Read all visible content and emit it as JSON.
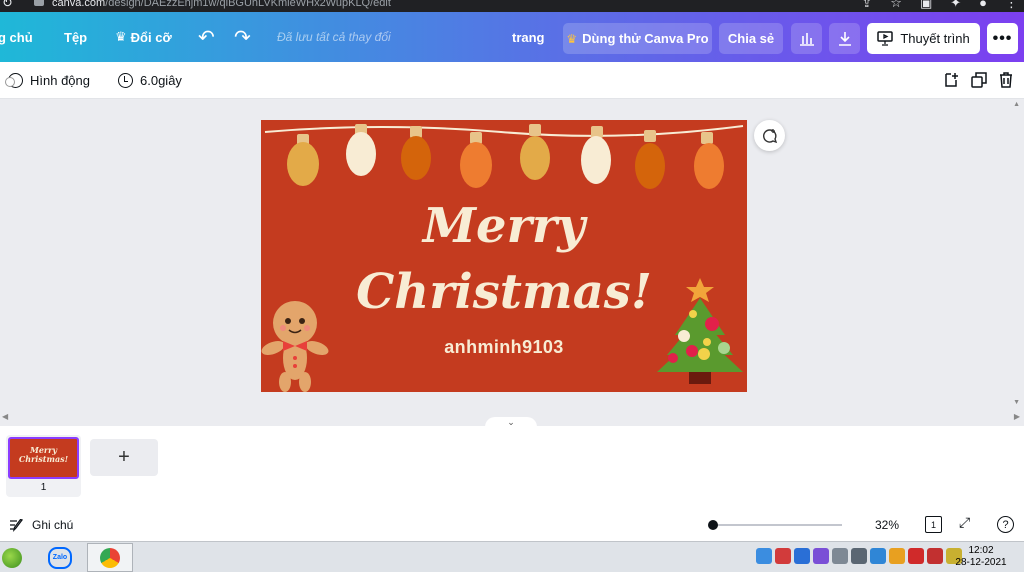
{
  "browser": {
    "url_host": "canva.com",
    "url_path": "/design/DAEzzEhjm1w/qlBGUhLVKmleWHx2WupKLQ/edit"
  },
  "topbar": {
    "home_label": "g chủ",
    "file_label": "Tệp",
    "resize_label": "Đổi cỡ",
    "saved_status": "Đã lưu tất cả thay đổi",
    "page_label": "trang",
    "pro_label": "Dùng thử Canva Pro",
    "share_label": "Chia sẻ",
    "present_label": "Thuyết trình",
    "more_label": "•••",
    "colors": {
      "gradient_start": "#1fb8d8",
      "gradient_end": "#7c3ff0",
      "crown": "#ffc43d"
    }
  },
  "subbar": {
    "animate_label": "Hình động",
    "duration_label": "6.0giây"
  },
  "design": {
    "title_line1": "Merry",
    "title_line2": "Christmas!",
    "username": "anhminh9103",
    "background_color": "#c43b1f",
    "text_color": "#f8ecd4"
  },
  "pages": {
    "thumb_line1": "Merry",
    "thumb_line2": "Christmas!",
    "thumb_number": "1",
    "add_label": "+"
  },
  "footer": {
    "notes_label": "Ghi chú",
    "zoom": "32%",
    "page_count": "1",
    "help": "?"
  },
  "taskbar": {
    "zalo_label": "Zalo",
    "time": "12:02",
    "date": "28-12-2021"
  }
}
